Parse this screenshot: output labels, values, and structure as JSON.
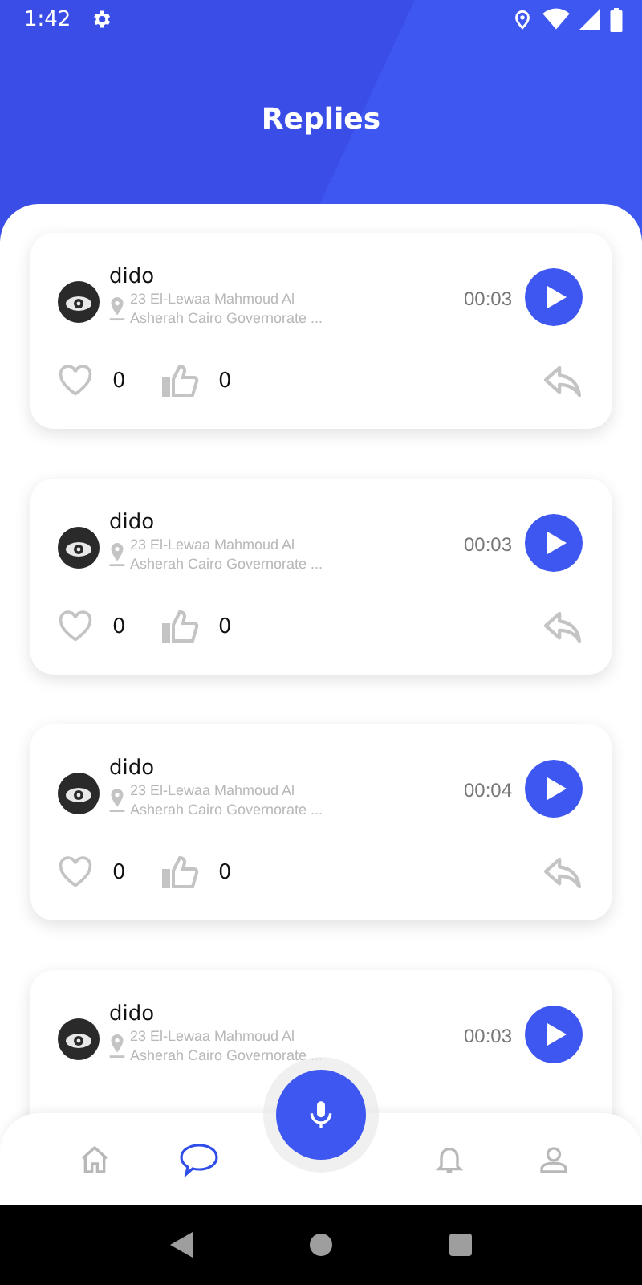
{
  "status_bar": {
    "time": "1:42"
  },
  "header": {
    "title": "Replies"
  },
  "replies": [
    {
      "name": "dido",
      "address_line_1": "23 El-Lewaa Mahmoud Al",
      "address_line_2": "Asherah Cairo Governorate ...",
      "duration": "00:03",
      "likes": "0",
      "thumbs": "0"
    },
    {
      "name": "dido",
      "address_line_1": "23 El-Lewaa Mahmoud Al",
      "address_line_2": "Asherah Cairo Governorate ...",
      "duration": "00:03",
      "likes": "0",
      "thumbs": "0"
    },
    {
      "name": "dido",
      "address_line_1": "23 El-Lewaa Mahmoud Al",
      "address_line_2": "Asherah Cairo Governorate ...",
      "duration": "00:04",
      "likes": "0",
      "thumbs": "0"
    },
    {
      "name": "dido",
      "address_line_1": "23 El-Lewaa Mahmoud Al",
      "address_line_2": "Asherah Cairo Governorate ...",
      "duration": "00:03"
    }
  ],
  "bottom_nav": [
    {
      "kind": "home",
      "selected": false
    },
    {
      "kind": "chat",
      "selected": true
    },
    {
      "kind": "bell",
      "selected": false
    },
    {
      "kind": "profile",
      "selected": false
    }
  ]
}
